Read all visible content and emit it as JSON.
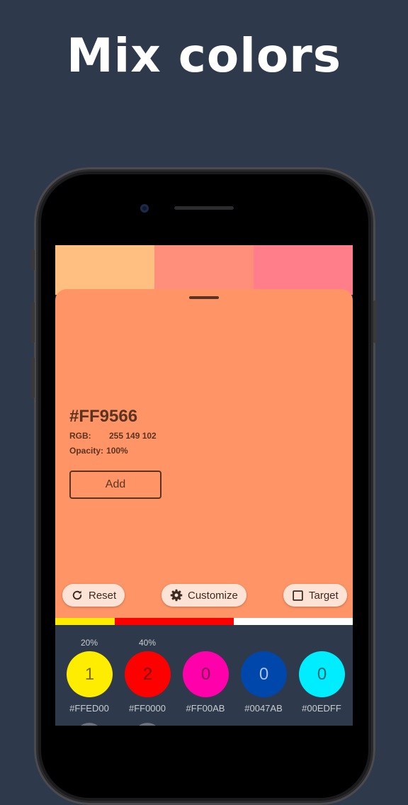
{
  "headline": "Mix colors",
  "swatches": [
    "#FFBF80",
    "#FF8F7A",
    "#FF7E8A"
  ],
  "sheet": {
    "hex": "#FF9566",
    "rgb_label": "RGB:",
    "rgb_value": "255 149 102",
    "opacity_label": "Opacity:",
    "opacity_value": "100%",
    "add_label": "Add",
    "background": "#FF9566"
  },
  "toolbar": {
    "reset_label": "Reset",
    "reset_icon": "refresh-icon",
    "customize_label": "Customize",
    "customize_icon": "gear-icon",
    "target_label": "Target",
    "target_icon": "checkbox-icon"
  },
  "mix_bar": [
    {
      "color": "#FFED00",
      "fraction": 0.2
    },
    {
      "color": "#FF0000",
      "fraction": 0.4
    },
    {
      "color": "#FFFFFF",
      "fraction": 0.4
    }
  ],
  "palette": [
    {
      "percent": "20%",
      "count": "1",
      "code": "#FFED00",
      "color": "#FFED00",
      "text_color": "#7a6a00"
    },
    {
      "percent": "40%",
      "count": "2",
      "code": "#FF0000",
      "color": "#FF0000",
      "text_color": "#7a0000"
    },
    {
      "percent": "",
      "count": "0",
      "code": "#FF00AB",
      "color": "#FF00AB",
      "text_color": "#7a0052"
    },
    {
      "percent": "",
      "count": "0",
      "code": "#0047AB",
      "color": "#0047AB",
      "text_color": "#a9c3ea"
    },
    {
      "percent": "",
      "count": "0",
      "code": "#00EDFF",
      "color": "#00EDFF",
      "text_color": "#006a72"
    }
  ]
}
